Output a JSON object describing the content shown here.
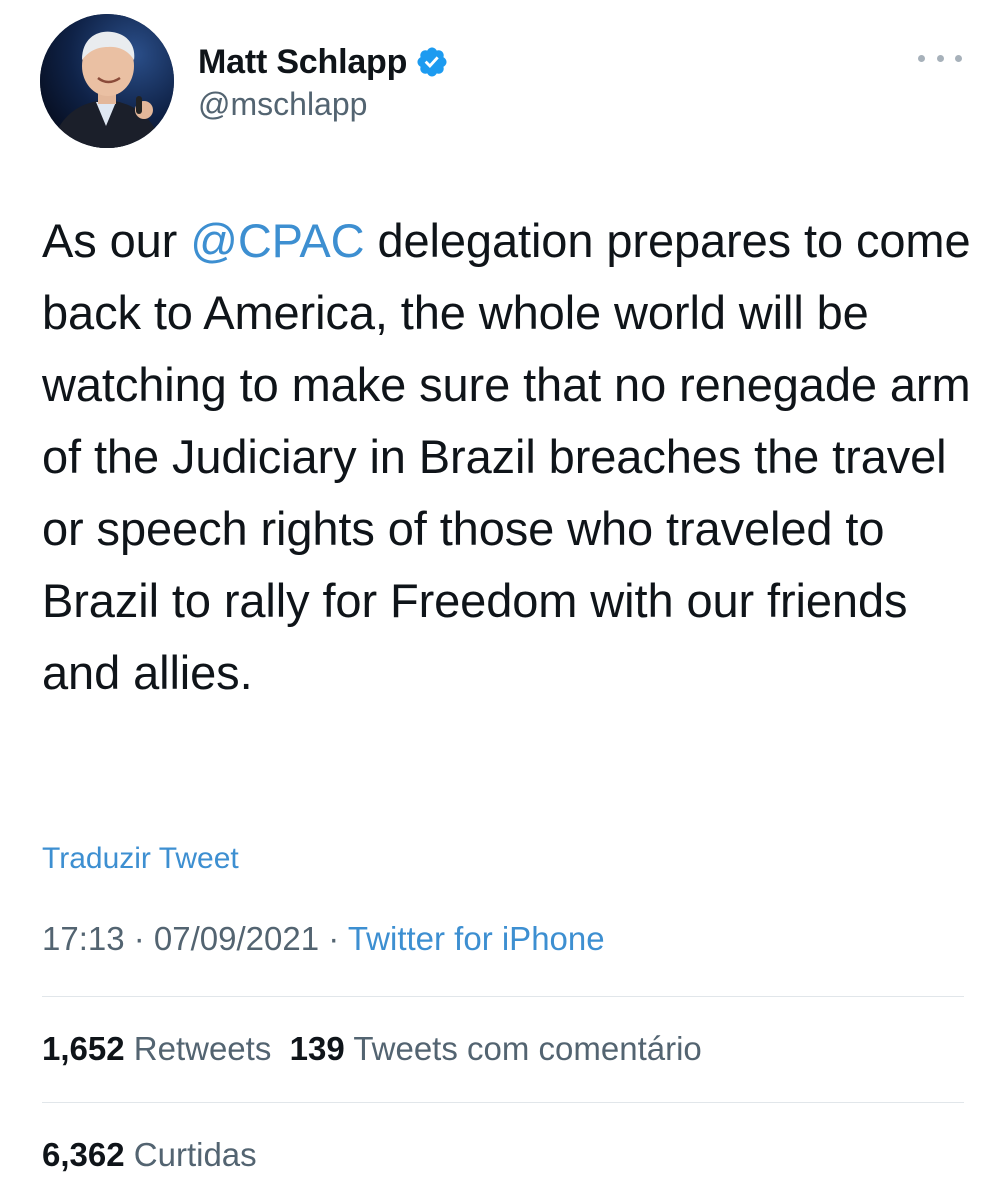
{
  "author": {
    "display_name": "Matt Schlapp",
    "handle": "@mschlapp",
    "verified": true,
    "verified_icon": "verified-badge-icon",
    "avatar_icon": "avatar-photo"
  },
  "tweet": {
    "text_before_mention": "As our ",
    "mention": "@CPAC",
    "text_after_mention": " delegation prepares to come back to America, the whole world will be watching to make sure that no renegade arm of the Judiciary in Brazil breaches the travel or speech rights of those who traveled to Brazil to rally for Freedom with our friends and allies."
  },
  "translate_label": "Traduzir Tweet",
  "meta": {
    "time": "17:13",
    "separator": " · ",
    "date": "07/09/2021",
    "source": "Twitter for iPhone"
  },
  "stats": {
    "retweets_count": "1,652",
    "retweets_label": "Retweets",
    "quotes_count": "139",
    "quotes_label": "Tweets com comentário",
    "likes_count": "6,362",
    "likes_label": "Curtidas"
  },
  "colors": {
    "link": "#3d8fd1",
    "verified": "#1d9bf0",
    "secondary_text": "#536471",
    "primary_text": "#0f1419"
  }
}
